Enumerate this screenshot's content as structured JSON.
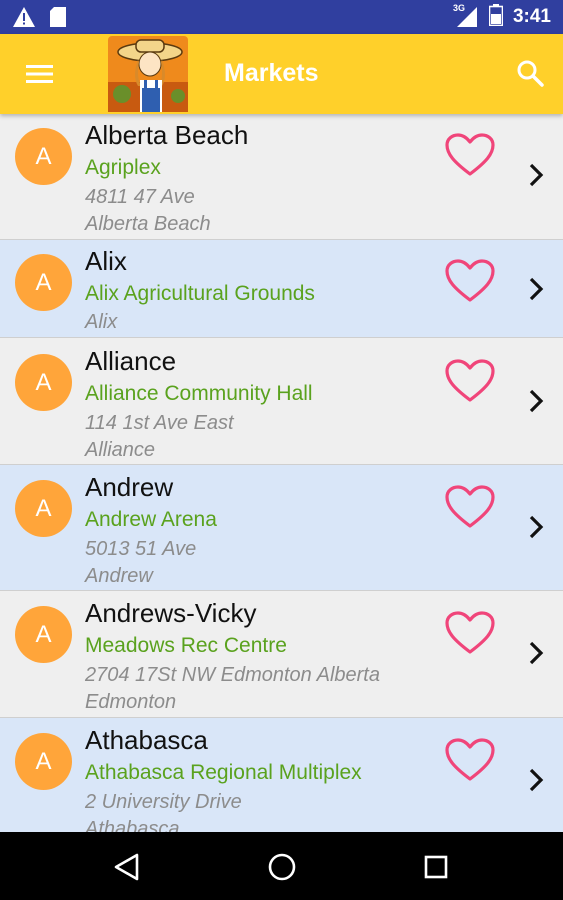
{
  "status_bar": {
    "time": "3:41",
    "network_label": "3G",
    "icons": [
      "warning-icon",
      "sd-card-icon",
      "signal-icon",
      "battery-icon"
    ]
  },
  "app_bar": {
    "title": "Markets",
    "menu_icon": "hamburger-menu-icon",
    "search_icon": "search-icon",
    "logo": "farmer-girl-logo"
  },
  "colors": {
    "app_bar": "#ffd02a",
    "status_bar": "#303f9f",
    "avatar": "#ffa53a",
    "venue_text": "#5aa21e",
    "heart": "#f0457a",
    "row_alt": "#d9e6f8",
    "row": "#efefef"
  },
  "markets": [
    {
      "initial": "A",
      "name": "Alberta Beach",
      "venue": "Agriplex",
      "address": "4811 47 Ave",
      "city": "Alberta Beach"
    },
    {
      "initial": "A",
      "name": "Alix",
      "venue": "Alix Agricultural Grounds",
      "address": "",
      "city": "Alix"
    },
    {
      "initial": "A",
      "name": "Alliance",
      "venue": "Alliance Community Hall",
      "address": "114 1st Ave East",
      "city": "Alliance"
    },
    {
      "initial": "A",
      "name": "Andrew",
      "venue": "Andrew Arena",
      "address": "5013 51 Ave",
      "city": "Andrew"
    },
    {
      "initial": "A",
      "name": "Andrews-Vicky",
      "venue": "Meadows Rec Centre",
      "address": "2704 17St NW Edmonton Alberta",
      "city": "Edmonton"
    },
    {
      "initial": "A",
      "name": "Athabasca",
      "venue": "Athabasca Regional Multiplex",
      "address": "2 University Drive",
      "city": "Athabasca"
    }
  ],
  "nav_bar": {
    "buttons": [
      "back-icon",
      "home-icon",
      "recents-icon"
    ]
  }
}
